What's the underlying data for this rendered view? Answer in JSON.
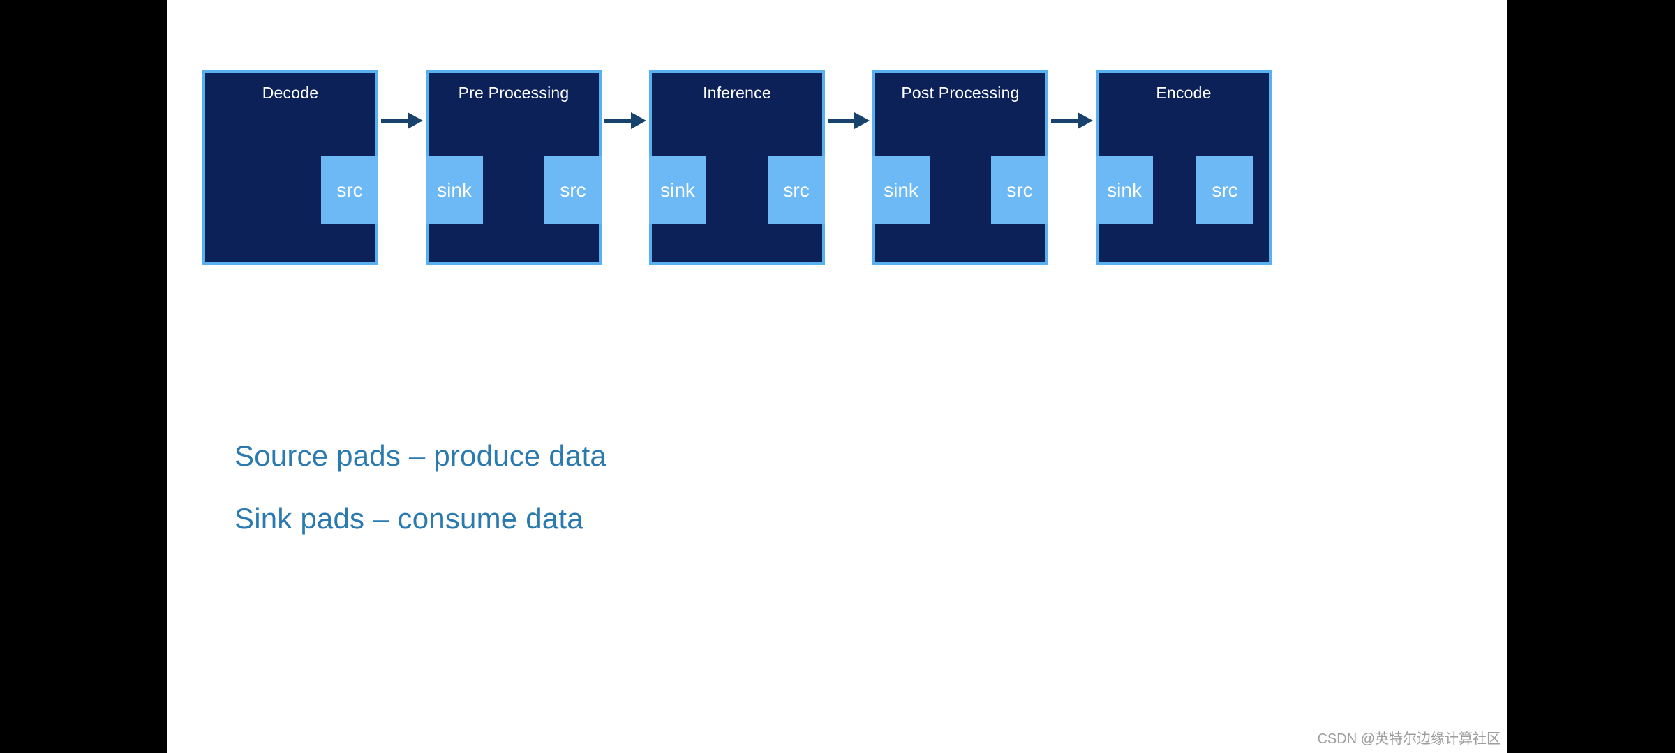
{
  "slide": {
    "background": "#ffffff",
    "letterbox_color": "#000000"
  },
  "palette": {
    "node_fill": "#0D2159",
    "node_border": "#59B0EE",
    "pad_fill": "#6CB9F5",
    "arrow": "#17426B",
    "caption_text": "#2A7AB0",
    "title_text": "#FFFFFF"
  },
  "pipeline": {
    "nodes": [
      {
        "title": "Decode",
        "sink": null,
        "src": "src"
      },
      {
        "title": "Pre Processing",
        "sink": "sink",
        "src": "src"
      },
      {
        "title": "Inference",
        "sink": "sink",
        "src": "src"
      },
      {
        "title": "Post Processing",
        "sink": "sink",
        "src": "src"
      },
      {
        "title": "Encode",
        "sink": "sink",
        "src": "src"
      }
    ],
    "connections": [
      {
        "from": "Decode",
        "to": "Pre Processing"
      },
      {
        "from": "Pre Processing",
        "to": "Inference"
      },
      {
        "from": "Inference",
        "to": "Post Processing"
      },
      {
        "from": "Post Processing",
        "to": "Encode"
      }
    ]
  },
  "captions": {
    "line1": "Source pads – produce data",
    "line2": "Sink pads – consume data"
  },
  "watermark": {
    "text": "CSDN @英特尔边缘计算社区"
  }
}
